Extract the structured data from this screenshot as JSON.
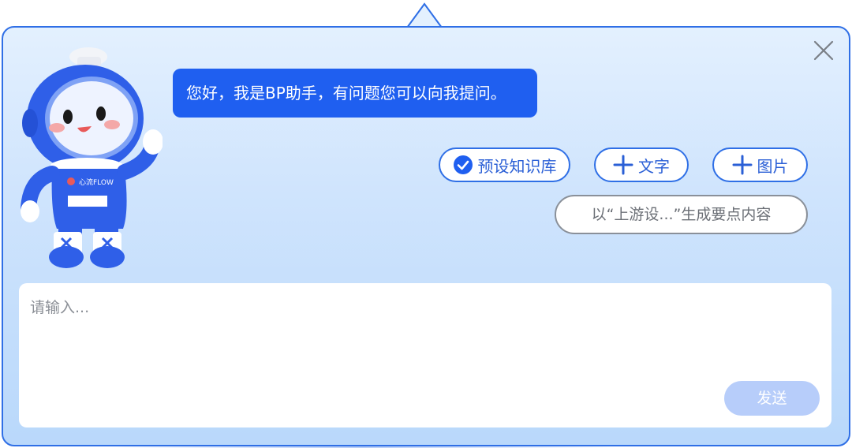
{
  "assistant": {
    "greeting": "您好，我是BP助手，有问题您可以向我提问。"
  },
  "mascot": {
    "badge_text": "心流FLOW"
  },
  "actions": {
    "knowledge_base_label": "预设知识库",
    "add_text_label": "文字",
    "add_image_label": "图片"
  },
  "suggestion": {
    "label": "以“上游设...”生成要点内容"
  },
  "input": {
    "placeholder": "请输入...",
    "value": ""
  },
  "send": {
    "label": "发送"
  },
  "icons": {
    "close": "close-icon",
    "check": "check-circle-icon",
    "plus": "plus-icon"
  },
  "colors": {
    "accent": "#1f5ff0",
    "border": "#2f6fe6",
    "send_disabled": "#b7cdfa",
    "panel_top": "#e3f0fe",
    "panel_bottom": "#b9d8fb"
  }
}
